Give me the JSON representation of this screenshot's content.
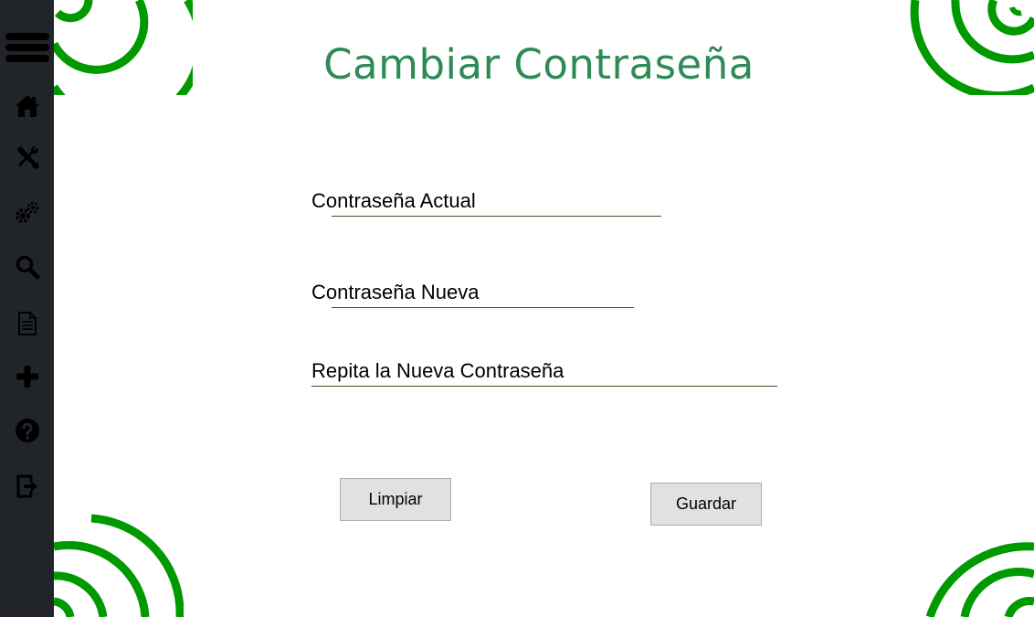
{
  "page": {
    "title": "Cambiar Contraseña"
  },
  "sidebar": {
    "items": [
      {
        "icon": "menu-icon"
      },
      {
        "icon": "home-icon"
      },
      {
        "icon": "tools-icon"
      },
      {
        "icon": "gears-icon"
      },
      {
        "icon": "search-icon"
      },
      {
        "icon": "document-icon"
      },
      {
        "icon": "plus-icon"
      },
      {
        "icon": "help-icon"
      },
      {
        "icon": "logout-icon"
      }
    ]
  },
  "form": {
    "current_password_label": "Contraseña Actual",
    "new_password_label": "Contraseña Nueva",
    "repeat_password_label": "Repita la Nueva Contraseña",
    "current_password_value": "",
    "new_password_value": "",
    "repeat_password_value": ""
  },
  "buttons": {
    "clear_label": "Limpiar",
    "save_label": "Guardar"
  },
  "colors": {
    "sidebar_bg": "#212529",
    "title": "#2e8b57",
    "spiral": "#009900"
  }
}
